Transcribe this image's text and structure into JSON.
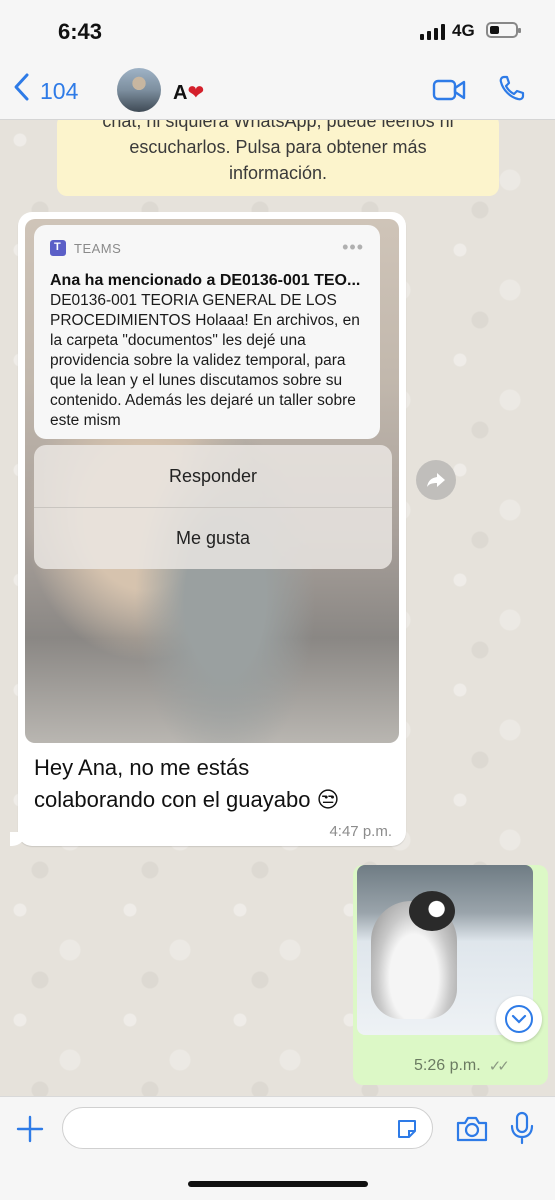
{
  "status_bar": {
    "time": "6:43",
    "network": "4G"
  },
  "header": {
    "back_count": "104",
    "contact_name": "A",
    "contact_heart": "❤"
  },
  "system_note": {
    "lines": [
      "chat, ni siquiera WhatsApp, puede leerlos ni",
      "escucharlos. Pulsa para obtener más",
      "información."
    ]
  },
  "messages": {
    "incoming": {
      "notification": {
        "app": "TEAMS",
        "title": "Ana ha mencionado a DE0136-001 TEO...",
        "body": "DE0136-001 TEORIA GENERAL DE LOS PROCEDIMIENTOS Holaaa! En archivos, en la carpeta \"documentos\" les dejé una providencia sobre la validez temporal, para que la lean y el lunes discutamos sobre su contenido. Además les dejaré un taller sobre este mism"
      },
      "actions": [
        "Responder",
        "Me gusta"
      ],
      "text_line1": "Hey Ana, no me estás",
      "text_line2": "colaborando con el guayabo 😒",
      "time": "4:47 p.m."
    },
    "outgoing": {
      "time": "5:26 p.m."
    }
  },
  "composer": {
    "placeholder": ""
  },
  "icons": {
    "back": "chevron-left-icon",
    "video": "video-camera-icon",
    "phone": "phone-icon",
    "forward": "forward-icon",
    "scroll": "chevron-down-icon",
    "plus": "plus-icon",
    "sticker": "sticker-icon",
    "camera": "camera-icon",
    "mic": "microphone-icon"
  },
  "colors": {
    "accent": "#2e7be7",
    "outgoing_bubble": "#dcf8c6",
    "system_note": "#fcf4cc"
  }
}
